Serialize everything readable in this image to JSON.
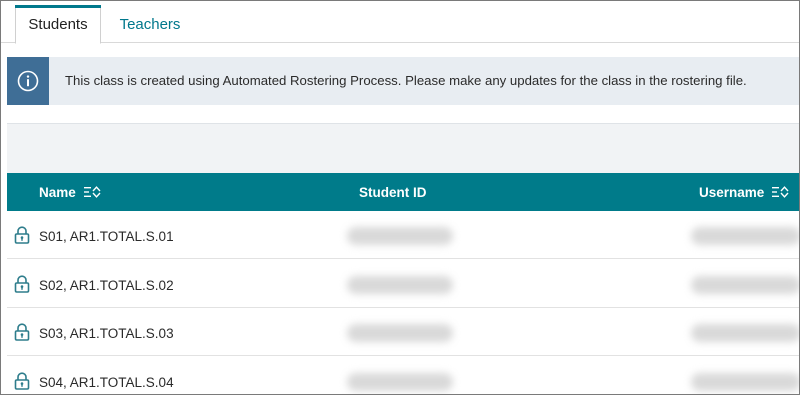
{
  "tabs": [
    {
      "label": "Students",
      "active": true
    },
    {
      "label": "Teachers",
      "active": false
    }
  ],
  "banner": {
    "icon": "info-icon",
    "message": "This class is created using Automated Rostering Process. Please make any updates for the class in the rostering file."
  },
  "table": {
    "columns": {
      "name": "Name",
      "student_id": "Student ID",
      "username": "Username"
    },
    "rows": [
      {
        "name": "S01, AR1.TOTAL.S.01",
        "icon": "lock-icon"
      },
      {
        "name": "S02, AR1.TOTAL.S.02",
        "icon": "lock-icon"
      },
      {
        "name": "S03, AR1.TOTAL.S.03",
        "icon": "lock-icon"
      },
      {
        "name": "S04, AR1.TOTAL.S.04",
        "icon": "lock-icon"
      }
    ]
  },
  "colors": {
    "accent": "#00788c",
    "header_bg": "#007b8a",
    "banner_icon_bg": "#3f6e96",
    "banner_bg": "#e8edf2"
  }
}
